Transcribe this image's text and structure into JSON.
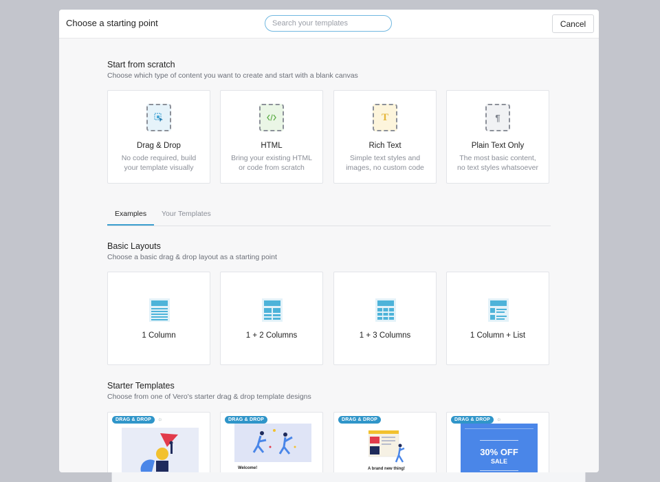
{
  "header": {
    "title": "Choose a starting point",
    "search_placeholder": "Search your templates",
    "cancel_label": "Cancel"
  },
  "scratch": {
    "title": "Start from scratch",
    "subtitle": "Choose which type of content you want to create and start with a blank canvas",
    "cards": [
      {
        "name": "Drag & Drop",
        "desc": "No code required, build your template visually",
        "icon": "drag-drop-icon"
      },
      {
        "name": "HTML",
        "desc": "Bring your existing HTML or code from scratch",
        "icon": "code-icon"
      },
      {
        "name": "Rich Text",
        "desc": "Simple text styles and images, no custom code",
        "icon": "rich-text-icon",
        "glyph": "T"
      },
      {
        "name": "Plain Text Only",
        "desc": "The most basic content, no text styles whatsoever",
        "icon": "pilcrow-icon",
        "glyph": "¶"
      }
    ]
  },
  "tabs": {
    "examples": "Examples",
    "your_templates": "Your Templates"
  },
  "basic_layouts": {
    "title": "Basic Layouts",
    "subtitle": "Choose a basic drag & drop layout as a starting point",
    "cards": [
      {
        "name": "1 Column",
        "icon": "one-column-layout-icon"
      },
      {
        "name": "1 + 2 Columns",
        "icon": "one-plus-two-columns-layout-icon"
      },
      {
        "name": "1 + 3 Columns",
        "icon": "one-plus-three-columns-layout-icon"
      },
      {
        "name": "1 Column + List",
        "icon": "one-column-list-layout-icon"
      }
    ]
  },
  "starter": {
    "title": "Starter Templates",
    "subtitle": "Choose from one of Vero's starter drag & drop template designs",
    "cards": [
      {
        "badge": "DRAG & DROP",
        "thumb_text": ""
      },
      {
        "badge": "DRAG & DROP",
        "thumb_text": "Welcome!"
      },
      {
        "badge": "DRAG & DROP",
        "thumb_text": "A brand new thing!"
      },
      {
        "badge": "DRAG & DROP",
        "thumb_text": "30% OFF",
        "thumb_text2": "SALE"
      }
    ]
  },
  "colors": {
    "accent": "#3b9fcf",
    "badge": "#2f95c9",
    "layout_icon": "#4db3d9",
    "sale_blue": "#4a86e8"
  }
}
